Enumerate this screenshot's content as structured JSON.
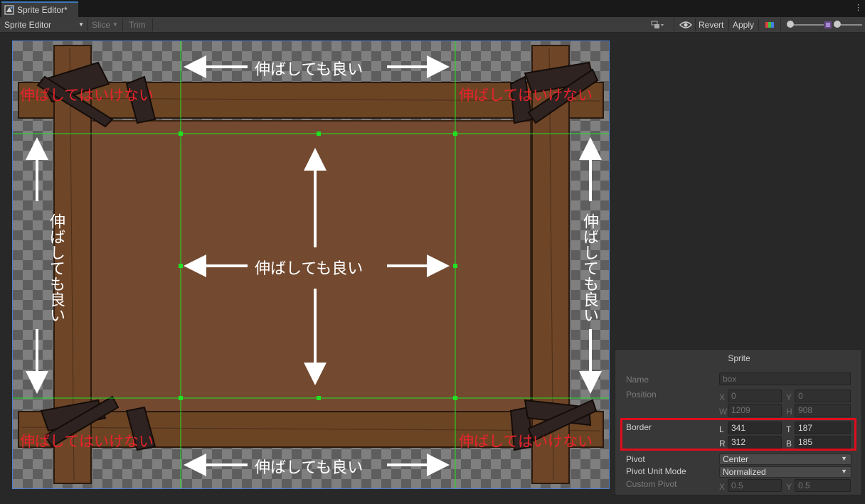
{
  "window": {
    "tab_title": "Sprite Editor*",
    "menu_glyph": "⋮"
  },
  "toolbar": {
    "mode": "Sprite Editor",
    "slice": "Slice",
    "trim": "Trim",
    "revert": "Revert",
    "apply": "Apply"
  },
  "canvas": {
    "stretch_ok": "伸ばしても良い",
    "no_stretch": "伸ばしてはいけない"
  },
  "sprite": {
    "panel_title": "Sprite",
    "name_label": "Name",
    "name_value": "box",
    "position_label": "Position",
    "x_label": "X",
    "x_value": "0",
    "y_label": "Y",
    "y_value": "0",
    "w_label": "W",
    "w_value": "1209",
    "h_label": "H",
    "h_value": "908",
    "border_label": "Border",
    "l_label": "L",
    "l_value": "341",
    "t_label": "T",
    "t_value": "187",
    "r_label": "R",
    "r_value": "312",
    "b_label": "B",
    "b_value": "185",
    "pivot_label": "Pivot",
    "pivot_value": "Center",
    "pivot_unit_label": "Pivot Unit Mode",
    "pivot_unit_value": "Normalized",
    "custom_pivot_label": "Custom Pivot",
    "cp_x_label": "X",
    "cp_x_value": "0.5",
    "cp_y_label": "Y",
    "cp_y_value": "0.5"
  },
  "colors": {
    "annotation_red": "#e8232b",
    "guide_green": "#22e022",
    "highlight_red": "#e00d1c"
  }
}
